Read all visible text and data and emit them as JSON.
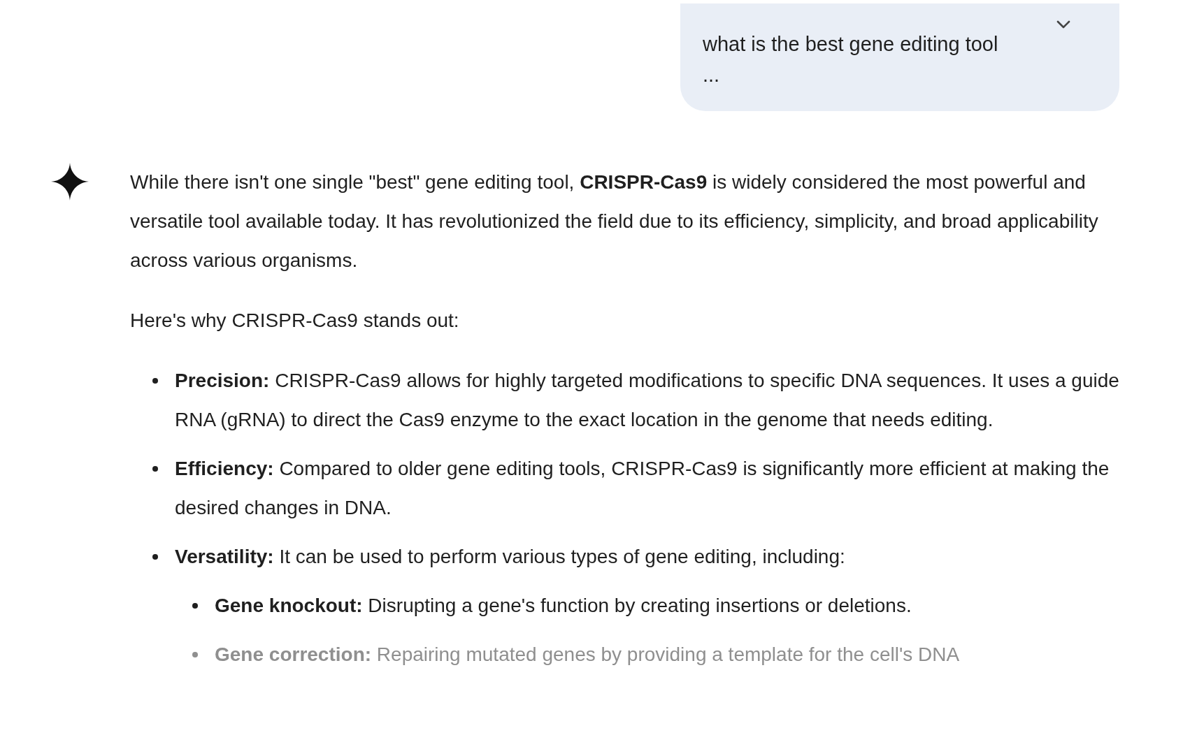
{
  "user_message": {
    "text": "what is the best gene editing tool",
    "more": "..."
  },
  "response": {
    "paragraphs": [
      "While there isn't one single \"best\" gene editing tool, **CRISPR-Cas9** is widely considered the most powerful and versatile tool available today. It has revolutionized the field due to its efficiency, simplicity, and broad applicability across various organisms.",
      "Here's why CRISPR-Cas9 stands out:"
    ],
    "bullets": [
      {
        "text": "**Precision:** CRISPR-Cas9 allows for highly targeted modifications to specific DNA sequences. It uses a guide RNA (gRNA) to direct the Cas9 enzyme to the exact location in the genome that needs editing.",
        "faded": false
      },
      {
        "text": "**Efficiency:** Compared to older gene editing tools, CRISPR-Cas9 is significantly more efficient at making the desired changes in DNA.",
        "faded": false
      },
      {
        "text": "**Versatility:** It can be used to perform various types of gene editing, including:",
        "faded": false,
        "children": [
          {
            "text": "**Gene knockout:** Disrupting a gene's function by creating insertions or deletions.",
            "faded": false
          },
          {
            "text": "**Gene correction:** Repairing mutated genes by providing a template for the cell's DNA",
            "faded": true
          }
        ]
      }
    ]
  }
}
